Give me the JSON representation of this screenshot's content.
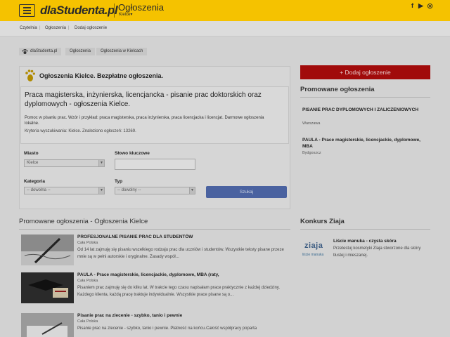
{
  "header": {
    "logo": "dlaStudenta.pl",
    "section_title": "Ogłoszenia",
    "city": "Kielce▾",
    "social": [
      "f",
      "▶",
      "◎"
    ]
  },
  "top_breadcrumb": [
    "Czytelnia",
    "Ogłoszenia",
    "Dodaj ogłoszenie"
  ],
  "path": [
    "dlaStudenta.pl",
    "Ogłoszenia",
    "Ogłoszenia w Kielcach"
  ],
  "panel": {
    "title": "Ogłoszenia Kielce. Bezpłatne ogłoszenia.",
    "query_title": "Praca magisterska, inżynierska, licencjancka - pisanie prac doktorskich oraz dyplomowych - ogłoszenia Kielce.",
    "query_desc": "Pomoc w pisaniu prac. Wzór i przykład: praca magisterska, praca inżynierska, praca licencjacka i licencjat. Darmowe ogłoszenia lokalne.",
    "criteria": "Kryteria wyszukiwania: Kielce. Znaleziono ogłoszeń: 13269."
  },
  "form": {
    "miasto_label": "Miasto",
    "miasto_value": "Kielce",
    "keyword_label": "Słowo kluczowe",
    "kategoria_label": "Kategoria",
    "kategoria_value": "-- dowolna --",
    "typ_label": "Typ",
    "typ_value": "-- dowolny --",
    "search_button": "Szukaj"
  },
  "promoted": {
    "heading": "Promowane ogłoszenia - Ogłoszenia Kielce",
    "items": [
      {
        "title": "PROFESJONALNE PISANIE PRAC DLA STUDENTÓW",
        "location": "Cała Polska",
        "text": "Od 14 lat zajmuję się pisaniu wszelkiego rodzaju prac dla uczniów i studentów. Wszystkie teksty pisane przeze mnie są w pełni autorskie i oryginalne. Zasady współ..."
      },
      {
        "title": "PAULA - Prace magisterskie, licencjackie, dyplomowe, MBA (raty,",
        "location": "Cała Polska",
        "text": "Pisaniem prac zajmuję się do kilku lat. W trakcie tego czasu napisałam prace praktycznie z każdej dziedziny. Każdego klienta, każdą pracę traktuje indywidualnie. Wszystkie prace pisane są o..."
      },
      {
        "title": "Pisanie prac na zlecenie - szybko, tanio i pewnie",
        "location": "Cała Polska",
        "text": "Pisanie prac na zlecenie - szybko, tanio i pewnie. Płatność na końcu.Całość współpracy poparta"
      }
    ]
  },
  "sidebar": {
    "add_button": "+ Dodaj ogłoszenie",
    "promoted_heading": "Promowane ogłoszenia",
    "promoted_items": [
      {
        "title": "PISANIE PRAC DYPLOMOWYCH I ZALICZENIOWYCH",
        "location": "Warszawa"
      },
      {
        "title": "PAULA - Prace magisterskie, licencjackie, dyplomowe, MBA",
        "location": "Bydgoszcz"
      }
    ],
    "contest_heading": "Konkurs Ziaja",
    "contest_logo": "ziaja",
    "contest_logo_sub": "liście manuka",
    "contest_title": "Liście manuka - czysta skóra",
    "contest_text": "Przetestuj kosmetyki Ziaja stworzone dla skóry tłustej i mieszanej."
  }
}
